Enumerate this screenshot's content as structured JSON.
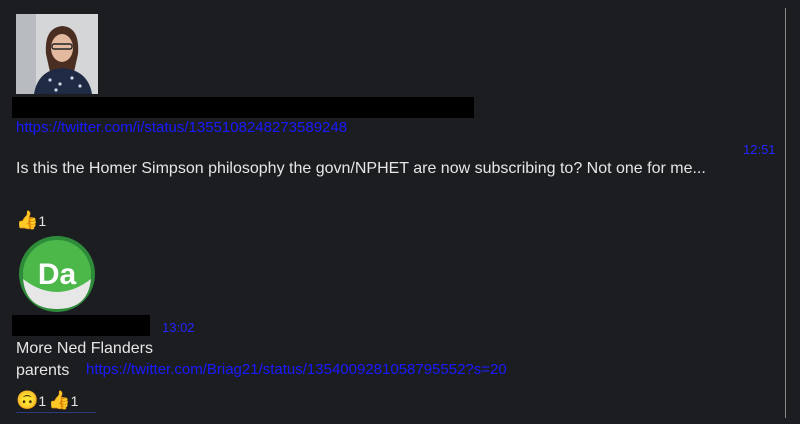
{
  "message1": {
    "link": "https://twitter.com/i/status/1355108248273589248",
    "time": "12:51",
    "text": "Is this the Homer Simpson philosophy the govn/NPHET are now subscribing to? Not one for me...",
    "reactions": [
      {
        "icon": "thumbs-up",
        "emoji": "👍",
        "count": "1"
      }
    ]
  },
  "message2": {
    "avatar_text": "Da",
    "avatar_color": "#3fae4a",
    "time": "13:02",
    "text_prefix": "More Ned Flanders parents",
    "link": "https://twitter.com/Briag21/status/1354009281058795552?s=20",
    "reactions": [
      {
        "icon": "upside-down-face",
        "emoji": "🙃",
        "count": "1"
      },
      {
        "icon": "thumbs-up",
        "emoji": "👍",
        "count": "1"
      }
    ]
  }
}
